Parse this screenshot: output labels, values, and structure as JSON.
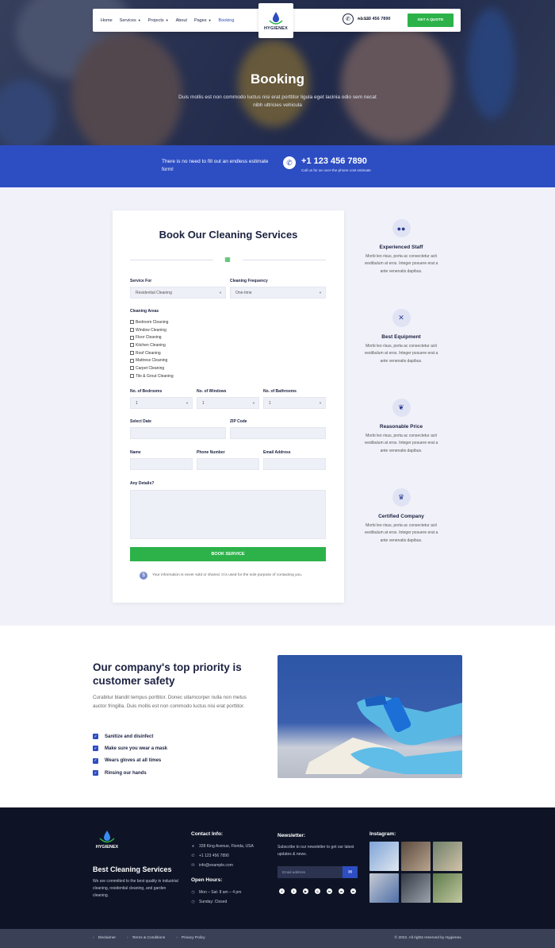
{
  "nav": {
    "links": [
      {
        "label": "Home",
        "dropdown": false
      },
      {
        "label": "Services",
        "dropdown": true
      },
      {
        "label": "Projects",
        "dropdown": true
      },
      {
        "label": "About",
        "dropdown": false
      },
      {
        "label": "Pages",
        "dropdown": true
      },
      {
        "label": "Booking",
        "dropdown": false,
        "active": true
      }
    ],
    "logo": "HYGIENEX",
    "hotline_label": "Hotline",
    "hotline_number": "+1 123 456 7890",
    "quote_button": "GET A QUOTE"
  },
  "hero": {
    "title": "Booking",
    "subtitle": "Duis mollis est non commodo luctus nisi erat porttitor ligula eget lacinia odio sem necat nibh ultricies vehicula"
  },
  "banner": {
    "message": "There is no need to fill out an endless estimate form!",
    "phone": "+1 123 456 7890",
    "note": "Call us for an over-the-phone cost estimate"
  },
  "form": {
    "title": "Book Our Cleaning Services",
    "service_label": "Service For",
    "service_value": "Residential Cleaning",
    "frequency_label": "Cleaning Frequency",
    "frequency_value": "One-time",
    "areas_label": "Cleaning Areas",
    "areas": [
      "Bedroom Cleaning",
      "Window Cleaning",
      "Floor Cleaning",
      "Kitchen Cleaning",
      "Roof Cleaning",
      "Mattress Cleaning",
      "Carpet Cleaning",
      "Tile & Grout Cleaning"
    ],
    "bedrooms_label": "No. of Bedrooms",
    "bedrooms_value": "1",
    "windows_label": "No. of Windows",
    "windows_value": "1",
    "bathrooms_label": "No. of Bathrooms",
    "bathrooms_value": "1",
    "date_label": "Select Date",
    "zip_label": "ZIP Code",
    "name_label": "Name",
    "phone_label": "Phone Number",
    "email_label": "Email Address",
    "details_label": "Any Details?",
    "submit": "BOOK SERVICE",
    "privacy": "Your information is never sold or shared. It is used for the sole purpose of contacting you."
  },
  "features": [
    {
      "icon": "team-icon",
      "title": "Experienced Staff",
      "text": "Morbi leo risus, porta ac consectetur acit vestibulum at eros. Integer posuere erat a ante venenatis dapibus."
    },
    {
      "icon": "tools-icon",
      "title": "Best Equipment",
      "text": "Morbi leo risus, porta ac consectetur acit vestibulum at eros. Integer posuere erat a ante venenatis dapibus."
    },
    {
      "icon": "leaf-icon",
      "title": "Reasonable Price",
      "text": "Morbi leo risus, porta ac consectetur acit vestibulum at eros. Integer posuere erat a ante venenatis dapibus."
    },
    {
      "icon": "crown-icon",
      "title": "Certified Company",
      "text": "Morbi leo risus, porta ac consectetur acit vestibulum at eros. Integer posuere erat a ante venenatis dapibus."
    }
  ],
  "safety": {
    "title": "Our company's top priority is customer safety",
    "text": "Curabitur blandit tempus porttitor. Donec ullamcorper nulla non metus auctor fringilla. Duis mollis est non commodo luctus nisi erat porttitor.",
    "items": [
      "Sanitize and disinfect",
      "Make sure you wear a mask",
      "Wears gloves at all times",
      "Rinsing our hands"
    ]
  },
  "footer": {
    "logo": "HYGIENEX",
    "brand": "Best Cleaning Services",
    "about": "We are committed to the best quality in industrial cleaning, residential cleaning, and garden cleaning.",
    "contact_title": "Contact Info:",
    "address": "328 King Avenue, Florida, USA",
    "phone": "+1 123 456 7890",
    "email": "info@example.com",
    "hours_title": "Open Hours:",
    "hours_weekday": "Mon – Sat: 8 am – 4 pm",
    "hours_sunday": "Sunday: Closed",
    "newsletter_title": "Newsletter:",
    "newsletter_text": "Subscribe to our newsletter to get our latest updates & news.",
    "newsletter_placeholder": "Email address",
    "instagram_title": "Instagram:",
    "socials": [
      "facebook-icon",
      "twitter-icon",
      "youtube-icon",
      "instagram-icon",
      "linkedin-icon",
      "whatsapp-icon",
      "messenger-icon"
    ]
  },
  "bottom": {
    "links": [
      "Disclaimer",
      "Terms & Conditions",
      "Privacy Policy"
    ],
    "copyright": "© 2022. All rights reserved by Hygienex."
  },
  "colors": {
    "brand_blue": "#2d4dc3",
    "accent_green": "#2db24a",
    "footer_bg": "#0e1426"
  }
}
